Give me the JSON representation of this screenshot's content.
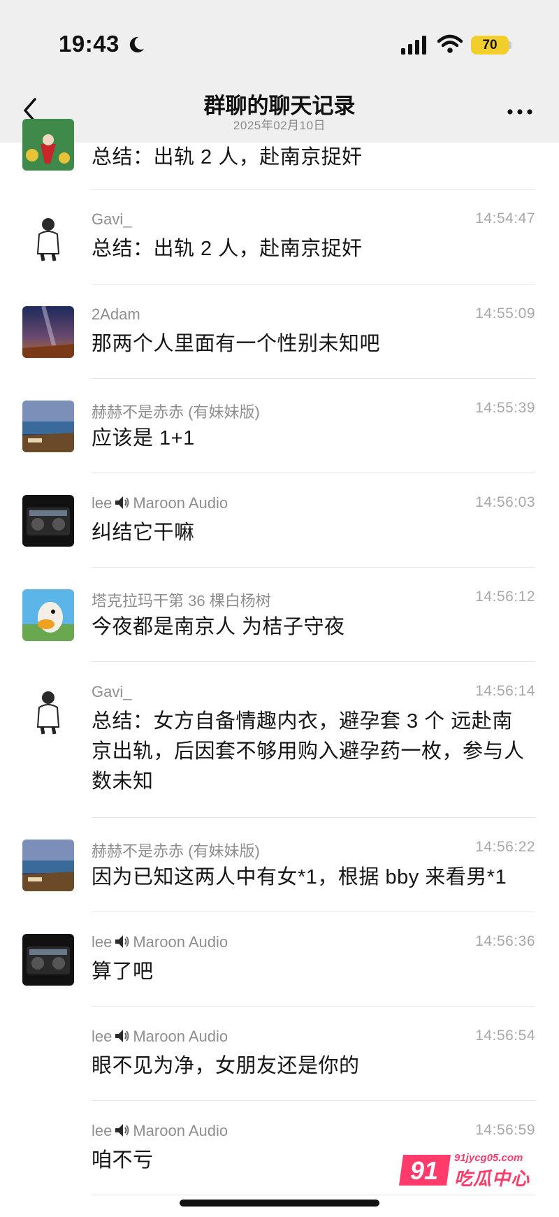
{
  "status_bar": {
    "time": "19:43",
    "battery": "70",
    "icons": [
      "moon-icon",
      "signal-icon",
      "wifi-icon",
      "battery-icon"
    ]
  },
  "nav": {
    "title": "群聊的聊天记录",
    "subtitle": "2025年02月10日",
    "back_icon": "chevron-left-icon",
    "more_icon": "more-icon"
  },
  "messages": [
    {
      "sender": "",
      "time": "",
      "text": "总结：出轨 2 人，赴南京捉奸"
    },
    {
      "sender": "Gavi_",
      "time": "14:54:47",
      "text": "总结：出轨 2 人，赴南京捉奸"
    },
    {
      "sender": "2Adam",
      "time": "14:55:09",
      "text": "那两个人里面有一个性别未知吧"
    },
    {
      "sender": "赫赫不是赤赤 (有妹妹版)",
      "time": "14:55:39",
      "text": "应该是 1+1"
    },
    {
      "sender_a": "lee",
      "sender_b": "Maroon Audio",
      "time": "14:56:03",
      "text": "纠结它干嘛"
    },
    {
      "sender": "塔克拉玛干第 36 棵白杨树",
      "time": "14:56:12",
      "text": "今夜都是南京人 为桔子守夜"
    },
    {
      "sender": "Gavi_",
      "time": "14:56:14",
      "text": "总结：女方自备情趣内衣，避孕套 3 个 远赴南京出轨，后因套不够用购入避孕药一枚，参与人数未知"
    },
    {
      "sender": "赫赫不是赤赤 (有妹妹版)",
      "time": "14:56:22",
      "text": "因为已知这两人中有女*1，根据 bby 来看男*1"
    },
    {
      "sender_a": "lee",
      "sender_b": "Maroon Audio",
      "time": "14:56:36",
      "text": "算了吧"
    },
    {
      "sender_a": "lee",
      "sender_b": "Maroon Audio",
      "time": "14:56:54",
      "text": "眼不见为净，女朋友还是你的"
    },
    {
      "sender_a": "lee",
      "sender_b": "Maroon Audio",
      "time": "14:56:59",
      "text": "咱不亏"
    }
  ],
  "watermark": {
    "number": "91",
    "url": "91jycg05.com",
    "name": "吃瓜中心"
  },
  "colors": {
    "header_bg": "#efefef",
    "battery": "#f2ce2a",
    "divider": "#e6e6e6",
    "watermark": "#ff3b6b"
  }
}
